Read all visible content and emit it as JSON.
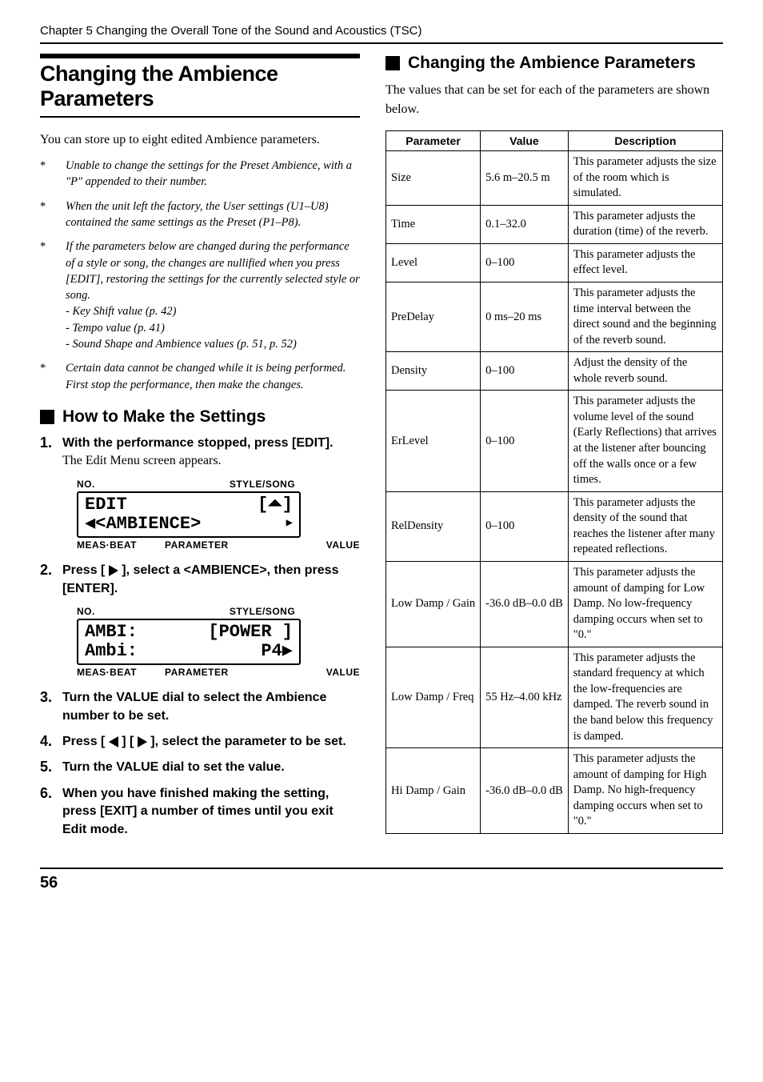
{
  "chapter_header": "Chapter 5 Changing the Overall Tone of the Sound and Acoustics (TSC)",
  "left": {
    "main_title": "Changing the Ambience Parameters",
    "intro": "You can store up to eight edited Ambience parameters.",
    "notes": [
      {
        "text": "Unable to change the settings for the Preset Ambience, with a \"P\" appended to their number."
      },
      {
        "text": "When the unit left the factory, the User settings (U1–U8) contained the same settings as the Preset (P1–P8)."
      },
      {
        "text": "If the parameters below are changed during the performance of a style or song, the changes are nullified when you press [EDIT], restoring the settings for the currently selected style or song.",
        "subs": [
          "- Key Shift value (p. 42)",
          "- Tempo value (p. 41)",
          "- Sound Shape and Ambience values (p. 51, p. 52)"
        ]
      },
      {
        "text": "Certain data cannot be changed while it is being performed. First stop the performance, then make the changes."
      }
    ],
    "howto_heading": "How to Make the Settings",
    "steps": [
      {
        "num": "1.",
        "bold": "With the performance stopped, press [EDIT].",
        "serif": "The Edit Menu screen appears."
      },
      {
        "num": "2.",
        "bold_pre": "Press [ ",
        "bold_post": " ], select a <AMBIENCE>, then press [ENTER]."
      },
      {
        "num": "3.",
        "bold": "Turn the VALUE dial to select the Ambience number to be set."
      },
      {
        "num": "4.",
        "bold_pre": "Press [ ",
        "bold_mid": " ] [ ",
        "bold_post": " ], select the parameter to be set."
      },
      {
        "num": "5.",
        "bold": "Turn the VALUE dial to set the value."
      },
      {
        "num": "6.",
        "bold": "When you have finished making the setting, press [EXIT] a number of times until you exit Edit mode."
      }
    ],
    "lcd_labels": {
      "no": "No.",
      "style_song": "STYLE/SONG",
      "meas_beat": "MEAS·BEAT",
      "parameter": "PARAMETER",
      "value": "VALUE"
    },
    "lcd1": {
      "line1_left": "EDIT",
      "line1_right": "[⏶]",
      "line2_left": "◀<AMBIENCE>",
      "line2_right": "▶"
    },
    "lcd2": {
      "line1_left": "AMBI:",
      "line1_right": "[POWER ]",
      "line2_left": " Ambi:",
      "line2_right": "P4▶"
    }
  },
  "right": {
    "heading": "Changing the Ambience Parameters",
    "intro": "The values that can be set for each of the parameters are shown below.",
    "table_headers": {
      "parameter": "Parameter",
      "value": "Value",
      "description": "Description"
    },
    "rows": [
      {
        "p": "Size",
        "v": "5.6 m–20.5 m",
        "d": "This parameter adjusts the size of the room which is simulated."
      },
      {
        "p": "Time",
        "v": "0.1–32.0",
        "d": "This parameter adjusts the duration (time) of the reverb."
      },
      {
        "p": "Level",
        "v": "0–100",
        "d": "This parameter adjusts the effect level."
      },
      {
        "p": "PreDelay",
        "v": "0 ms–20 ms",
        "d": "This parameter adjusts the time interval between the direct sound and the beginning of the reverb sound."
      },
      {
        "p": "Density",
        "v": "0–100",
        "d": "Adjust the density of the whole reverb sound."
      },
      {
        "p": "ErLevel",
        "v": "0–100",
        "d": "This parameter adjusts the volume level of the sound (Early Reflections) that arrives at the listener after bouncing off the walls once or a few times."
      },
      {
        "p": "RelDensity",
        "v": "0–100",
        "d": "This parameter adjusts the density of the sound that reaches the listener after many repeated reflections."
      },
      {
        "p": "Low Damp / Gain",
        "v": "-36.0 dB–0.0 dB",
        "d": "This parameter adjusts the amount of damping for Low Damp. No low-frequency damping occurs when set to \"0.\""
      },
      {
        "p": "Low Damp / Freq",
        "v": "55 Hz–4.00 kHz",
        "d": "This parameter adjusts the standard frequency at which the low-frequencies are damped. The reverb sound in the band below this frequency is damped."
      },
      {
        "p": "Hi Damp / Gain",
        "v": "-36.0 dB–0.0 dB",
        "d": "This parameter adjusts the amount of damping for High Damp. No high-frequency damping occurs when set to \"0.\""
      }
    ]
  },
  "page_number": "56"
}
